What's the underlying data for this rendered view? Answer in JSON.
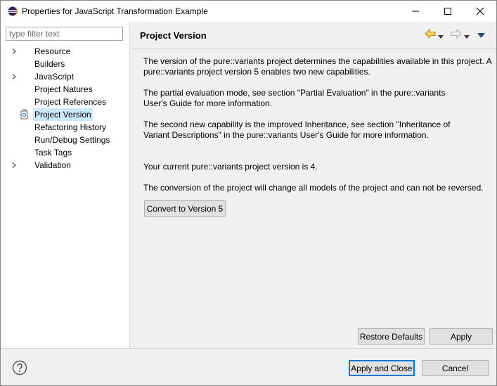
{
  "window": {
    "title": "Properties for JavaScript Transformation Example",
    "controls": {
      "minimize": "minimize",
      "maximize": "maximize",
      "close": "close"
    }
  },
  "filter": {
    "placeholder": "type filter text",
    "value": ""
  },
  "tree": {
    "items": [
      {
        "label": "Resource",
        "expandable": true,
        "selected": false
      },
      {
        "label": "Builders",
        "expandable": false,
        "selected": false
      },
      {
        "label": "JavaScript",
        "expandable": true,
        "selected": false
      },
      {
        "label": "Project Natures",
        "expandable": false,
        "selected": false
      },
      {
        "label": "Project References",
        "expandable": false,
        "selected": false
      },
      {
        "label": "Project Version",
        "expandable": false,
        "selected": true
      },
      {
        "label": "Refactoring History",
        "expandable": false,
        "selected": false
      },
      {
        "label": "Run/Debug Settings",
        "expandable": false,
        "selected": false
      },
      {
        "label": "Task Tags",
        "expandable": false,
        "selected": false
      },
      {
        "label": "Validation",
        "expandable": true,
        "selected": false
      }
    ]
  },
  "page": {
    "title": "Project Version",
    "paragraphs": [
      "The version of the pure::variants project determines the capabilities available in this project. A pure::variants project version 5 enables two new capabilities.",
      "The partial evaluation mode, see section \"Partial Evaluation\" in the pure::variants User's Guide for more information.",
      "The second new capability is the improved Inheritance, see section \"Inheritance of Variant Descriptions\" in the pure::variants User's Guide for more information.",
      "Your current pure::variants project version is 4.",
      "The conversion of the project will change all models of the project and can not be reversed."
    ],
    "convert_label": "Convert to Version 5",
    "restore_label": "Restore Defaults",
    "apply_label": "Apply"
  },
  "footer": {
    "apply_close_label": "Apply and Close",
    "cancel_label": "Cancel"
  },
  "colors": {
    "selection": "#cce8ff",
    "accent": "#0078d7",
    "nav_arrow": "#d4a017"
  }
}
